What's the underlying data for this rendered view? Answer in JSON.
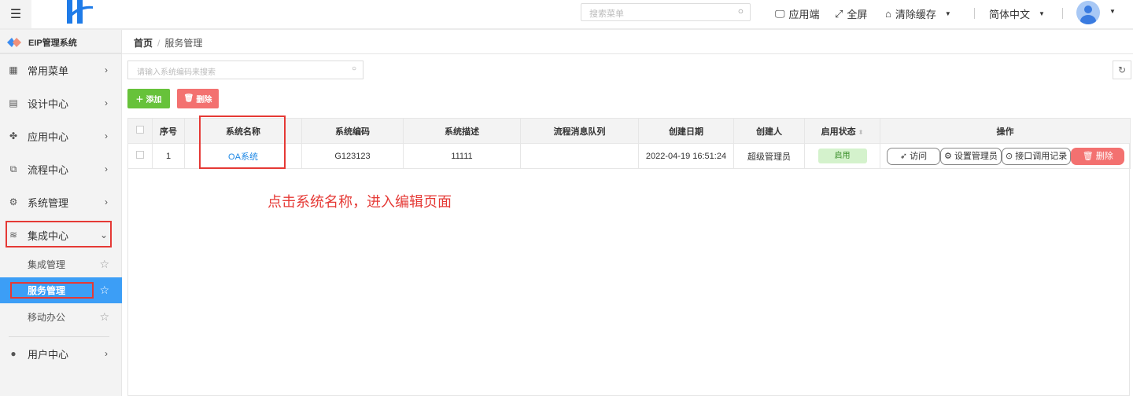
{
  "header": {
    "search_placeholder": "搜索菜单",
    "app_label": "应用端",
    "fullscreen_label": "全屏",
    "clear_cache_label": "清除缓存",
    "language": "简体中文"
  },
  "sidebar": {
    "title": "EIP管理系统",
    "items": [
      {
        "label": "常用菜单"
      },
      {
        "label": "设计中心"
      },
      {
        "label": "应用中心"
      },
      {
        "label": "流程中心"
      },
      {
        "label": "系统管理"
      },
      {
        "label": "集成中心"
      }
    ],
    "sub_items": [
      {
        "label": "集成管理"
      },
      {
        "label": "服务管理"
      },
      {
        "label": "移动办公"
      }
    ],
    "user_center": "用户中心"
  },
  "breadcrumb": {
    "home": "首页",
    "sep": "/",
    "current": "服务管理"
  },
  "toolbar": {
    "search_placeholder": "请输入系统编码来搜索",
    "add_label": "添加",
    "delete_label": "删除"
  },
  "table": {
    "headers": [
      "序号",
      "系统名称",
      "系统编码",
      "系统描述",
      "流程消息队列",
      "创建日期",
      "创建人",
      "启用状态",
      "操作"
    ],
    "rows": [
      {
        "index": "1",
        "name": "OA系统",
        "code": "G123123",
        "desc": "11111",
        "queue": "",
        "created": "2022-04-19 16:51:24",
        "creator": "超级管理员",
        "status": "启用",
        "actions": {
          "visit": "访问",
          "set_admin": "设置管理员",
          "api_log": "接口调用记录",
          "delete": "删除"
        }
      }
    ]
  },
  "annotation": "点击系统名称，进入编辑页面",
  "colors": {
    "accent": "#3c9ef6",
    "add": "#67c23a",
    "delete": "#f37170",
    "highlight": "#e53935"
  }
}
